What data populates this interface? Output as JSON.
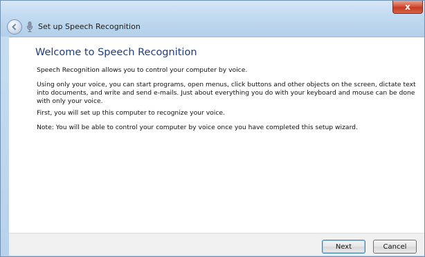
{
  "window": {
    "title": "Set up Speech Recognition",
    "close_glyph": "x"
  },
  "content": {
    "heading": "Welcome to Speech Recognition",
    "paragraphs": [
      "Speech Recognition allows you to control your computer by voice.",
      "Using only your voice, you can start programs, open menus, click buttons and other objects on the screen, dictate text into documents, and write and send e-mails. Just about everything you do with your keyboard and mouse can be done with only your voice.",
      "First, you will set up this computer to recognize your voice.",
      "Note: You will be able to control your computer by voice once you have completed this setup wizard."
    ]
  },
  "buttons": {
    "next": "Next",
    "cancel": "Cancel"
  },
  "colors": {
    "heading": "#1e3d7b",
    "close_button": "#c53a20",
    "frame": "#b7d2ec"
  },
  "icons": {
    "back": "back-arrow-icon",
    "title": "microphone-icon",
    "close": "close-icon"
  }
}
